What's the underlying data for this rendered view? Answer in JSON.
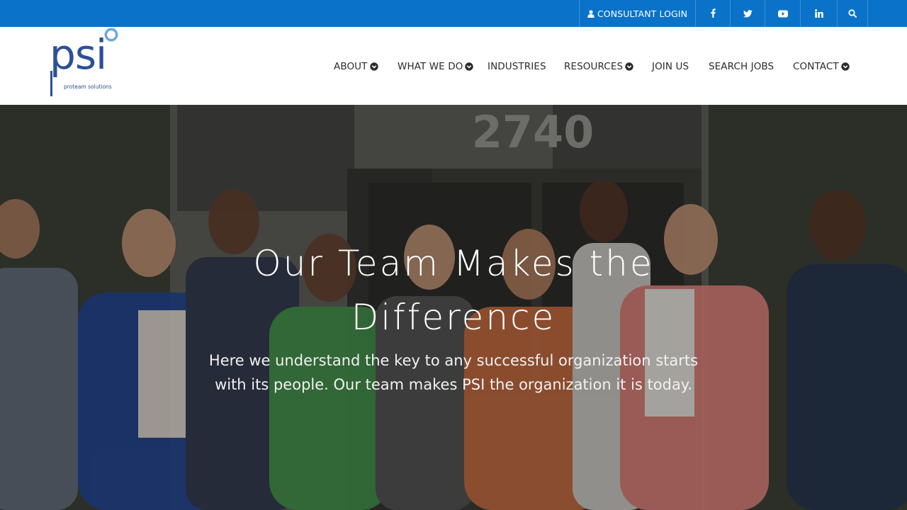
{
  "topbar": {
    "login_label": "CONSULTANT LOGIN",
    "login_icon": "user-icon",
    "social": [
      "facebook-icon",
      "twitter-icon",
      "youtube-icon",
      "linkedin-icon"
    ],
    "search_icon": "search-icon",
    "background": "#0a72c8"
  },
  "logo": {
    "name": "psi",
    "tagline": "proteam solutions",
    "color": "#2c4f97"
  },
  "nav": {
    "about": "ABOUT",
    "what_we_do": "WHAT WE DO",
    "industries": "INDUSTRIES",
    "resources": "RESOURCES",
    "join_us": "JOIN US",
    "search_jobs": "SEARCH JOBS",
    "contact": "CONTACT"
  },
  "hero": {
    "building_number": "2740",
    "title": "Our Team Makes the Difference",
    "subtitle": "Here we understand the key to any successful organization starts with its people.  Our team makes PSI the organization it is today."
  }
}
